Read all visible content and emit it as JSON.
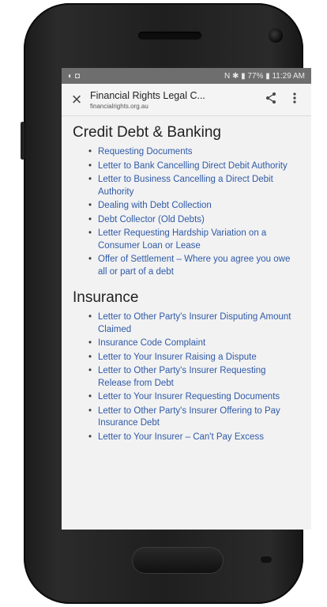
{
  "status": {
    "left_icons": "◐ ◘",
    "right_text": "N  ✱ ▮ 77% ▮ 11:29 AM"
  },
  "appbar": {
    "title": "Financial Rights Legal C...",
    "url": "financialrights.org.au",
    "close_icon": "×",
    "share_icon": "share-icon",
    "menu_icon": "more-vert-icon"
  },
  "sections": [
    {
      "heading": "Credit Debt & Banking",
      "items": [
        "Requesting Documents",
        "Letter to Bank Cancelling Direct Debit Authority",
        "Letter to Business Cancelling a Direct Debit Authority",
        "Dealing with Debt Collection",
        "Debt Collector (Old Debts)",
        "Letter Requesting Hardship Variation on a Consumer Loan or Lease",
        "Offer of Settlement – Where you agree you owe all or part of a debt"
      ]
    },
    {
      "heading": "Insurance",
      "items": [
        "Letter to Other Party's Insurer Disputing Amount Claimed",
        "Insurance Code Complaint",
        "Letter to Your Insurer Raising a Dispute",
        "Letter to Other Party's Insurer Requesting Release from Debt",
        "Letter to Your Insurer Requesting Documents",
        "Letter to Other Party's Insurer Offering to Pay Insurance Debt",
        "Letter to Your Insurer – Can't Pay Excess"
      ]
    }
  ]
}
